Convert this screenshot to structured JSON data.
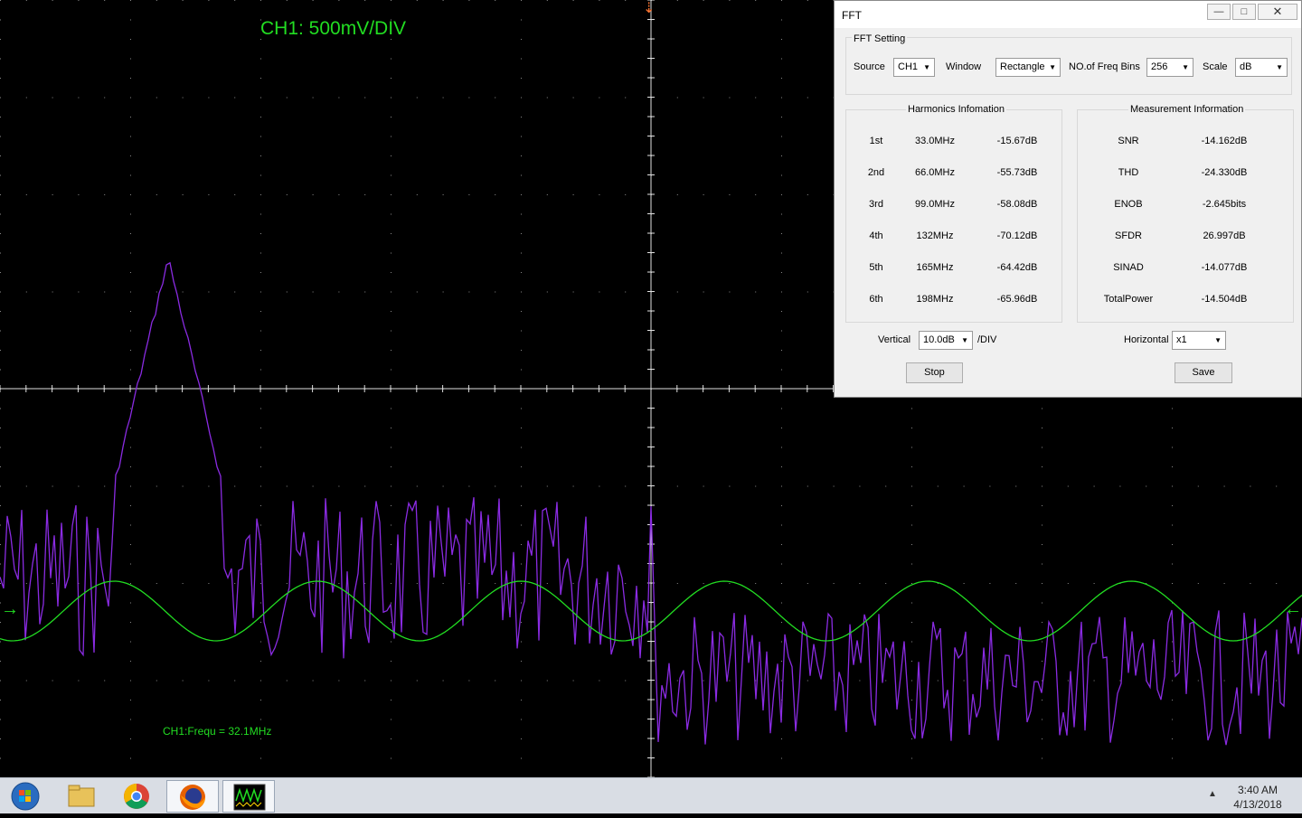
{
  "scope": {
    "channel_label": "CH1: 500mV/DIV",
    "frequency_readout": "CH1:Frequ = 32.1MHz",
    "colors": {
      "grid": "#e0e0e0",
      "ch1_trace": "#22dd22",
      "fft_trace": "#8a2be2",
      "trigger_marker": "#ff7733"
    },
    "icons": {
      "trigger": "trigger-marker-icon",
      "ch_left": "channel-ground-arrow-icon",
      "ch_right": "channel-ground-arrow-right-icon"
    }
  },
  "fft_window": {
    "title": "FFT",
    "titlebar_buttons": [
      "minimize",
      "maximize",
      "close"
    ],
    "settings": {
      "legend": "FFT Setting",
      "source_label": "Source",
      "source_value": "CH1",
      "window_label": "Window",
      "window_value": "Rectangle",
      "bins_label": "NO.of Freq Bins",
      "bins_value": "256",
      "scale_label": "Scale",
      "scale_value": "dB"
    },
    "harmonics": {
      "legend": "Harmonics Infomation",
      "rows": [
        {
          "order": "1st",
          "freq": "33.0MHz",
          "level": "-15.67dB"
        },
        {
          "order": "2nd",
          "freq": "66.0MHz",
          "level": "-55.73dB"
        },
        {
          "order": "3rd",
          "freq": "99.0MHz",
          "level": "-58.08dB"
        },
        {
          "order": "4th",
          "freq": "132MHz",
          "level": "-70.12dB"
        },
        {
          "order": "5th",
          "freq": "165MHz",
          "level": "-64.42dB"
        },
        {
          "order": "6th",
          "freq": "198MHz",
          "level": "-65.96dB"
        }
      ]
    },
    "measurement": {
      "legend": "Measurement Information",
      "rows": [
        {
          "name": "SNR",
          "value": "-14.162dB"
        },
        {
          "name": "THD",
          "value": "-24.330dB"
        },
        {
          "name": "ENOB",
          "value": "-2.645bits"
        },
        {
          "name": "SFDR",
          "value": "26.997dB"
        },
        {
          "name": "SINAD",
          "value": "-14.077dB"
        },
        {
          "name": "TotalPower",
          "value": "-14.504dB"
        }
      ]
    },
    "vertical_label": "Vertical",
    "vertical_value": "10.0dB",
    "vertical_unit": "/DIV",
    "horizontal_label": "Horizontal",
    "horizontal_value": "x1",
    "stop_button": "Stop",
    "save_button": "Save"
  },
  "taskbar": {
    "apps": [
      "file-explorer-icon",
      "chrome-icon",
      "firefox-icon",
      "oscilloscope-app-icon"
    ],
    "time": "3:40 AM",
    "date": "4/13/2018"
  }
}
